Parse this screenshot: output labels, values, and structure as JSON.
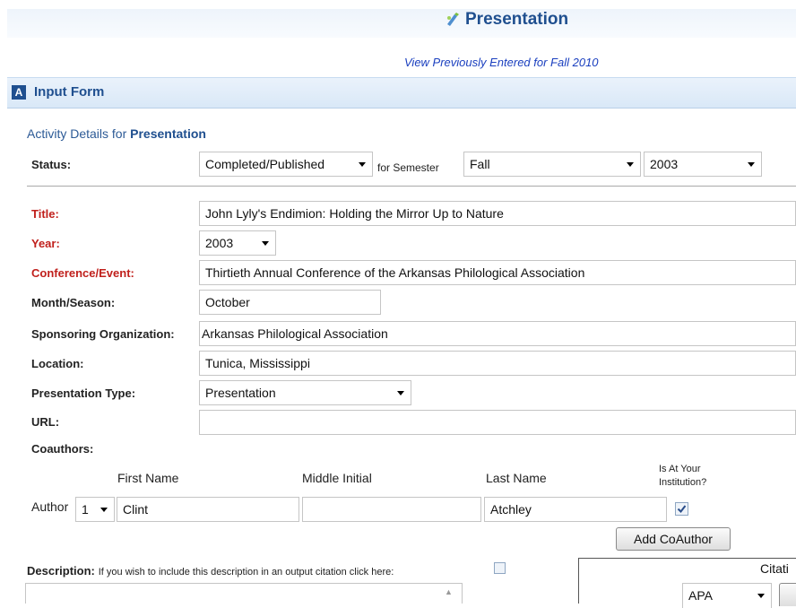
{
  "header": {
    "title": "Presentation",
    "view_link": "View Previously Entered for Fall 2010"
  },
  "section": {
    "letter": "A",
    "title": "Input Form"
  },
  "activity": {
    "prefix": "Activity Details for",
    "type": "Presentation"
  },
  "status": {
    "label": "Status:",
    "value": "Completed/Published",
    "for_semester": "for Semester",
    "semester": "Fall",
    "year": "2003"
  },
  "fields": {
    "title": {
      "label": "Title:",
      "value": "John Lyly's Endimion: Holding the Mirror Up to Nature"
    },
    "year": {
      "label": "Year:",
      "value": "2003"
    },
    "conference": {
      "label": "Conference/Event:",
      "value": "Thirtieth Annual Conference of the Arkansas Philological Association"
    },
    "month": {
      "label": "Month/Season:",
      "value": "October"
    },
    "sponsor": {
      "label": "Sponsoring Organization:",
      "value": "Arkansas Philological Association"
    },
    "location": {
      "label": "Location:",
      "value": "Tunica, Mississippi"
    },
    "ptype": {
      "label": "Presentation Type:",
      "value": "Presentation"
    },
    "url": {
      "label": "URL:",
      "value": ""
    }
  },
  "coauthors": {
    "label": "Coauthors:",
    "headers": {
      "first": "First Name",
      "middle": "Middle Initial",
      "last": "Last Name",
      "institution": "Is At Your Institution?"
    },
    "author_label": "Author",
    "author_num": "1",
    "first": "Clint",
    "middle": "",
    "last": "Atchley",
    "at_institution": true,
    "add_button": "Add CoAuthor"
  },
  "description": {
    "label": "Description:",
    "hint": "If you wish to include this description in an output citation click here:"
  },
  "citation": {
    "label": "Citati",
    "style": "APA"
  }
}
